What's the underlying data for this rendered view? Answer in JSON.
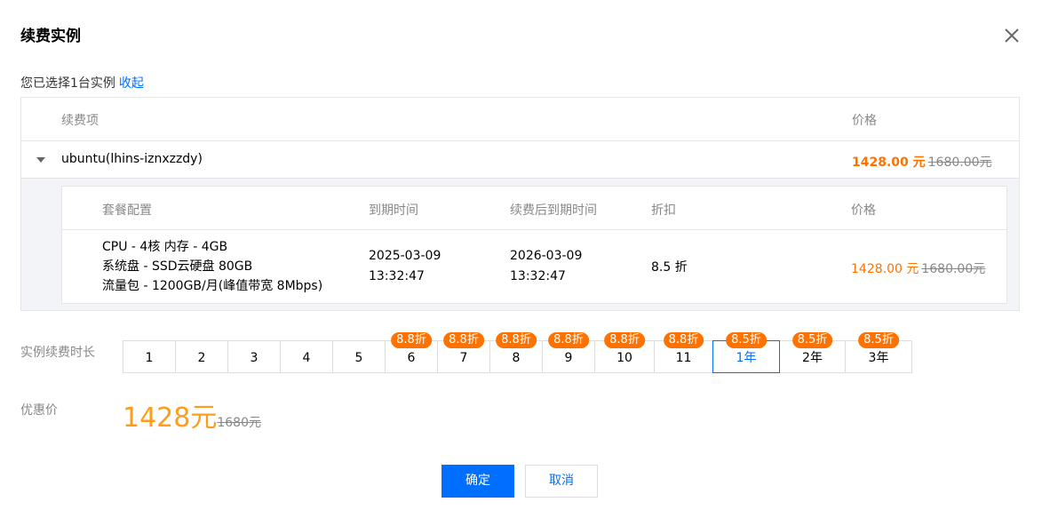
{
  "dialog": {
    "title": "续费实例"
  },
  "selection": {
    "text": "您已选择1台实例",
    "collapse_label": "收起"
  },
  "table": {
    "headers": {
      "item": "续费项",
      "price": "价格"
    },
    "instance": {
      "name": "ubuntu(lhins-iznxzzdy)",
      "price_now": "1428.00 元",
      "price_old": "1680.00元"
    },
    "detail": {
      "headers": {
        "config": "套餐配置",
        "expire": "到期时间",
        "renew_expire": "续费后到期时间",
        "discount": "折扣",
        "price": "价格"
      },
      "config_lines": [
        "CPU - 4核 内存 - 4GB",
        "系统盘 - SSD云硬盘 80GB",
        "流量包 - 1200GB/月(峰值带宽 8Mbps)"
      ],
      "expire": {
        "date": "2025-03-09",
        "time": "13:32:47"
      },
      "renew_expire": {
        "date": "2026-03-09",
        "time": "13:32:47"
      },
      "discount": "8.5 折",
      "price_now": "1428.00 元",
      "price_old": "1680.00元"
    }
  },
  "duration": {
    "label": "实例续费时长",
    "selected": "1年",
    "options": [
      {
        "label": "1",
        "badge": ""
      },
      {
        "label": "2",
        "badge": ""
      },
      {
        "label": "3",
        "badge": ""
      },
      {
        "label": "4",
        "badge": ""
      },
      {
        "label": "5",
        "badge": ""
      },
      {
        "label": "6",
        "badge": "8.8折"
      },
      {
        "label": "7",
        "badge": "8.8折"
      },
      {
        "label": "8",
        "badge": "8.8折"
      },
      {
        "label": "9",
        "badge": "8.8折"
      },
      {
        "label": "10",
        "badge": "8.8折"
      },
      {
        "label": "11",
        "badge": "8.8折"
      },
      {
        "label": "1年",
        "badge": "8.5折"
      },
      {
        "label": "2年",
        "badge": "8.5折"
      },
      {
        "label": "3年",
        "badge": "8.5折"
      }
    ]
  },
  "promo": {
    "label": "优惠价",
    "price": "1428元",
    "old_price": "1680元"
  },
  "buttons": {
    "ok": "确定",
    "cancel": "取消"
  },
  "colors": {
    "primary": "#006eff",
    "accent": "#ff7200",
    "promo": "#ff9c19"
  },
  "icons": {
    "close": "close-icon",
    "caret": "caret-down-icon"
  }
}
